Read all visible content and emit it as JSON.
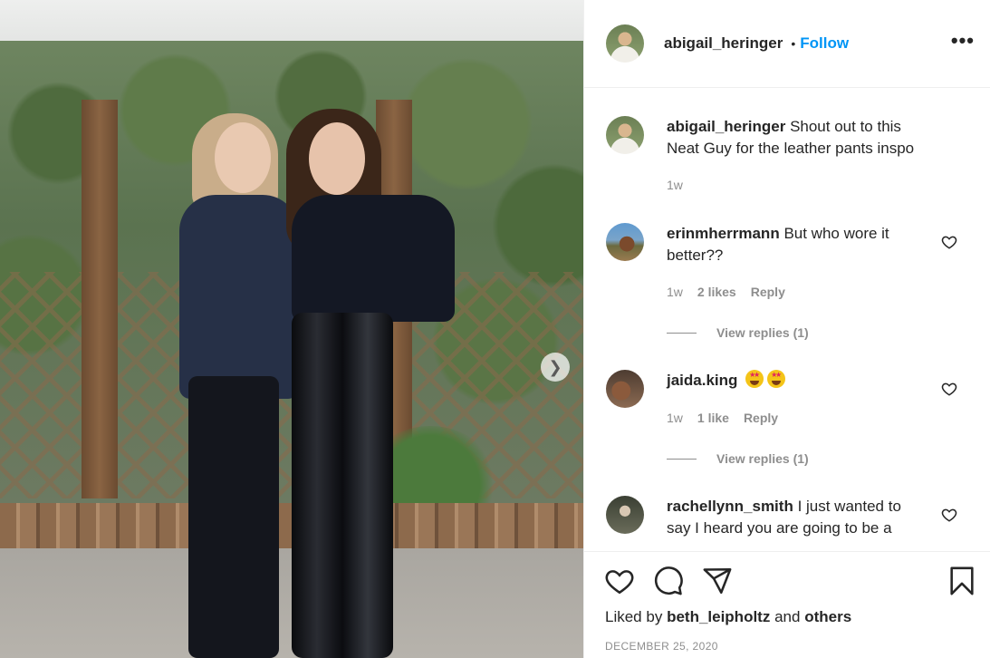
{
  "post": {
    "username": "abigail_heringer",
    "follow_label": "Follow",
    "caption": "Shout out to this Neat Guy for the leather pants inspo",
    "caption_time": "1w",
    "date": "DECEMBER 25, 2020",
    "liked_prefix": "Liked by",
    "liked_user": "beth_leipholtz",
    "liked_and": "and",
    "liked_others": "others"
  },
  "comments": [
    {
      "username": "erinmherrmann",
      "text": "But who wore it better??",
      "time": "1w",
      "likes": "2 likes",
      "reply": "Reply",
      "view_replies": "View replies (1)"
    },
    {
      "username": "jaida.king",
      "text": "",
      "time": "1w",
      "likes": "1 like",
      "reply": "Reply",
      "view_replies": "View replies (1)"
    },
    {
      "username": "rachellynn_smith",
      "text": "I just wanted to say I heard you are going to be a",
      "time": "",
      "likes": "",
      "reply": "",
      "view_replies": ""
    }
  ],
  "icons": [
    "more-options-icon",
    "heart-icon",
    "comment-icon",
    "share-icon",
    "bookmark-icon",
    "next-image-arrow-icon",
    "star-eyes-emoji"
  ],
  "colors": {
    "follow_blue": "#0095f6",
    "text": "#262626",
    "muted": "#8e8e8e",
    "divider": "#efefef"
  }
}
